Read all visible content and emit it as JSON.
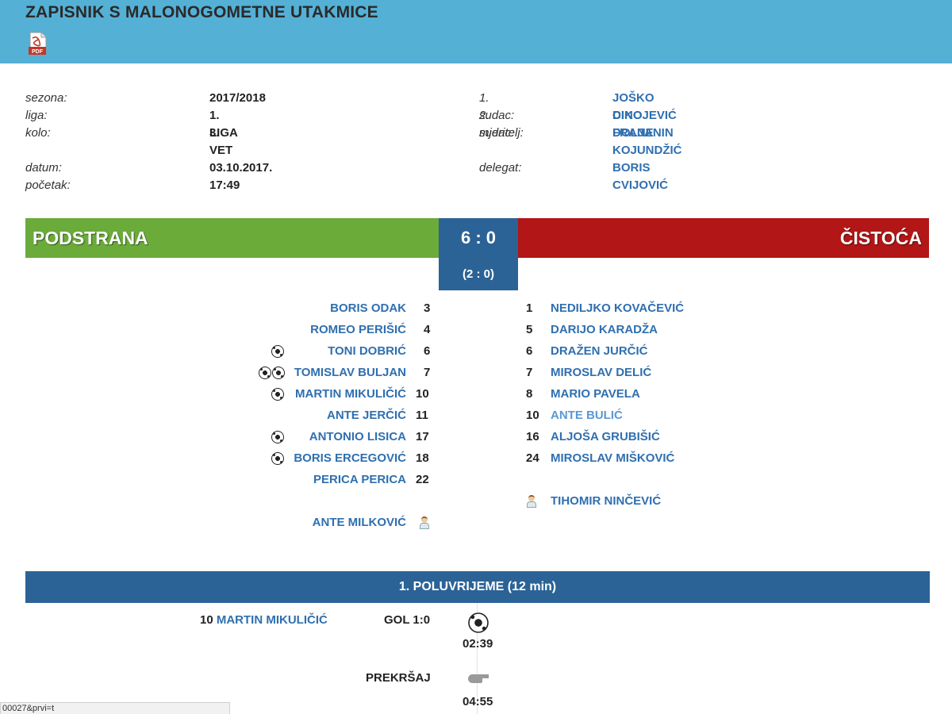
{
  "header": {
    "title": "ZAPISNIK S MALONOGOMETNE UTAKMICE",
    "pdf_icon_label": "PDF"
  },
  "match_info": {
    "season_label": "sezona:",
    "season": "2017/2018",
    "league_label": "liga:",
    "league": "1. LIGA VET",
    "round_label": "kolo:",
    "round": "3.",
    "date_label": "datum:",
    "date": "03.10.2017.",
    "start_label": "početak:",
    "start": "17:49",
    "referee1_label": "1. sudac:",
    "referee1": "JOŠKO CIKOJEVIĆ",
    "referee2_label": "2. sudac:",
    "referee2": "DINO DOLJANIN",
    "timekeeper_label": "mjeritelj:",
    "timekeeper": "FRANE KOJUNDŽIĆ",
    "delegate_label": "delegat:",
    "delegate": "BORIS CVIJOVIĆ"
  },
  "score": {
    "home_team": "PODSTRANA",
    "away_team": "ČISTOĆA",
    "final": "6 : 0",
    "halftime": "(2 : 0)",
    "home_color": "#6aab3a",
    "away_color": "#b21616",
    "score_color": "#2b6396"
  },
  "home_players": [
    {
      "name": "BORIS ODAK",
      "number": "3",
      "goals": 0
    },
    {
      "name": "ROMEO PERIŠIĆ",
      "number": "4",
      "goals": 0
    },
    {
      "name": "TONI DOBRIĆ",
      "number": "6",
      "goals": 1
    },
    {
      "name": "TOMISLAV BULJAN",
      "number": "7",
      "goals": 2
    },
    {
      "name": "MARTIN MIKULIČIĆ",
      "number": "10",
      "goals": 1
    },
    {
      "name": "ANTE JERČIĆ",
      "number": "11",
      "goals": 0
    },
    {
      "name": "ANTONIO LISICA",
      "number": "17",
      "goals": 1
    },
    {
      "name": "BORIS ERCEGOVIĆ",
      "number": "18",
      "goals": 1
    },
    {
      "name": "PERICA PERICA",
      "number": "22",
      "goals": 0
    }
  ],
  "home_coach": {
    "name": "ANTE MILKOVIĆ",
    "icon": "coach-icon"
  },
  "away_players": [
    {
      "name": "NEDILJKO KOVAČEVIĆ",
      "number": "1"
    },
    {
      "name": "DARIJO KARADŽA",
      "number": "5"
    },
    {
      "name": "DRAŽEN JURČIĆ",
      "number": "6"
    },
    {
      "name": "MIROSLAV DELIĆ",
      "number": "7"
    },
    {
      "name": "MARIO PAVELA",
      "number": "8"
    },
    {
      "name": "ANTE BULIĆ",
      "number": "10"
    },
    {
      "name": "ALJOŠA GRUBIŠIĆ",
      "number": "16"
    },
    {
      "name": "MIROSLAV MIŠKOVIĆ",
      "number": "24"
    }
  ],
  "away_coach": {
    "name": "TIHOMIR NINČEVIĆ",
    "icon": "coach-icon"
  },
  "half": {
    "title": "1. POLUVRIJEME (12 min)"
  },
  "events": [
    {
      "player_number": "10",
      "player_name": "MARTIN MIKULIČIĆ",
      "type": "GOL 1:0",
      "time": "02:39",
      "icon": "ball-icon"
    },
    {
      "player_number": "",
      "player_name": "",
      "type": "PREKRŠAJ",
      "time": "04:55",
      "icon": "whistle-icon"
    }
  ],
  "statusbar": {
    "url_fragment": "00027&prvi=t"
  }
}
